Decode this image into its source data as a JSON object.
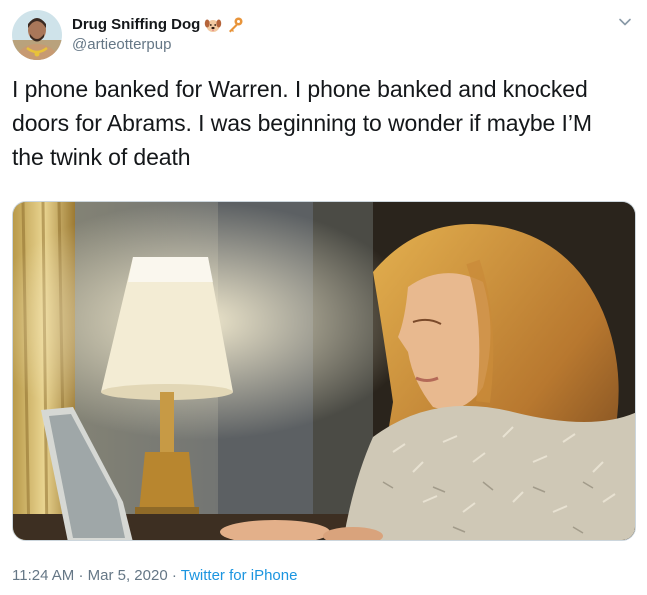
{
  "tweet": {
    "author": {
      "display_name": "Drug Sniffing Dog",
      "handle": "@artieotterpup",
      "name_emojis": [
        "dog-face-emoji",
        "key-emoji"
      ]
    },
    "text_lines": [
      "I phone banked for Warren. I phone banked and knocked",
      "doors for Abrams. I was beginning to wonder if maybe I’M",
      "the twink of death"
    ],
    "time": "11:24 AM",
    "separator1": "·",
    "date": "Mar 5, 2020",
    "separator2": "·",
    "source": "Twitter for iPhone"
  },
  "colors": {
    "text": "#14171a",
    "secondary": "#657786",
    "link": "#1b95e0"
  },
  "icons": {
    "menu": "chevron-down-icon"
  }
}
